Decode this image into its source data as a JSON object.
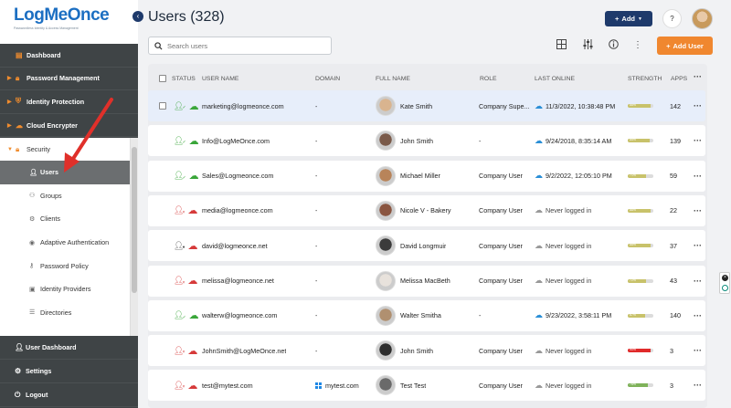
{
  "brand": {
    "name_part1": "LogMe",
    "name_part2": "Once",
    "tagline": "Passwordless Identity & Access Management"
  },
  "sidebar": {
    "top_items": [
      {
        "label": "Dashboard",
        "icon": "dashboard-icon"
      },
      {
        "label": "Password Management",
        "icon": "lock-icon"
      },
      {
        "label": "Identity Protection",
        "icon": "shield-icon"
      },
      {
        "label": "Cloud Encrypter",
        "icon": "cloud-icon"
      }
    ],
    "security": {
      "label": "Security",
      "icon": "lock-icon"
    },
    "sub_items": [
      {
        "label": "Users",
        "icon": "user-icon",
        "active": true
      },
      {
        "label": "Groups",
        "icon": "groups-icon"
      },
      {
        "label": "Clients",
        "icon": "clients-icon"
      },
      {
        "label": "Adaptive Authentication",
        "icon": "adaptive-icon"
      },
      {
        "label": "Password Policy",
        "icon": "key-icon"
      },
      {
        "label": "Identity Providers",
        "icon": "id-icon"
      },
      {
        "label": "Directories",
        "icon": "directory-icon"
      }
    ],
    "bottom_items": [
      {
        "label": "User Dashboard",
        "icon": "user-icon"
      },
      {
        "label": "Settings",
        "icon": "gear-icon"
      },
      {
        "label": "Logout",
        "icon": "power-icon"
      }
    ]
  },
  "header": {
    "title": "Users (328)",
    "add_label": "Add",
    "help_label": "?",
    "search_placeholder": "Search users",
    "add_user_label": "Add User"
  },
  "table": {
    "columns": [
      "STATUS",
      "USER NAME",
      "DOMAIN",
      "FULL NAME",
      "ROLE",
      "LAST ONLINE",
      "STRENGTH",
      "APPS"
    ],
    "rows": [
      {
        "status": "active",
        "username": "marketing@logmeonce.com",
        "domain": "-",
        "full_name": "Kate Smith",
        "role": "Company Supe...",
        "last_online": "11/3/2022, 10:38:48 PM",
        "online_type": "cloud",
        "strength": "88%",
        "strength_value": 0.88,
        "strength_color": "#c8c26a",
        "apps": "142",
        "face": "#d9b48f",
        "highlight": true
      },
      {
        "status": "active",
        "username": "Info@LogMeOnce.com",
        "domain": "-",
        "full_name": "John Smith",
        "role": "-",
        "last_online": "9/24/2018, 8:35:14 AM",
        "online_type": "cloud",
        "strength": "85%",
        "strength_value": 0.85,
        "strength_color": "#c8c26a",
        "apps": "139",
        "face": "#7a5a4a"
      },
      {
        "status": "active",
        "username": "Sales@Logmeonce.com",
        "domain": "-",
        "full_name": "Michael Miller",
        "role": "Company User",
        "last_online": "9/2/2022, 12:05:10 PM",
        "online_type": "cloud",
        "strength": "71%",
        "strength_value": 0.71,
        "strength_color": "#c8c26a",
        "apps": "59",
        "face": "#b8845a"
      },
      {
        "status": "inactive",
        "username": "media@logmeonce.com",
        "domain": "-",
        "full_name": "Nicole V - Bakery",
        "role": "Company User",
        "last_online": "Never logged in",
        "online_type": "never",
        "strength": "88%",
        "strength_value": 0.88,
        "strength_color": "#c8c26a",
        "apps": "22",
        "face": "#8a5540"
      },
      {
        "status": "pending",
        "username": "david@logmeonce.net",
        "domain": "-",
        "full_name": "David Longmuir",
        "role": "Company User",
        "last_online": "Never logged in",
        "online_type": "never",
        "strength": "88%",
        "strength_value": 0.88,
        "strength_color": "#c8c26a",
        "apps": "37",
        "face": "#3b3b3b"
      },
      {
        "status": "inactive",
        "username": "melissa@logmeonce.net",
        "domain": "-",
        "full_name": "Melissa MacBeth",
        "role": "Company User",
        "last_online": "Never logged in",
        "online_type": "never",
        "strength": "72%",
        "strength_value": 0.72,
        "strength_color": "#c8c26a",
        "apps": "43",
        "face": "#e8e2dc"
      },
      {
        "status": "active",
        "username": "walterw@logmeonce.com",
        "domain": "-",
        "full_name": "Walter Smitha",
        "role": "-",
        "last_online": "9/23/2022, 3:58:11 PM",
        "online_type": "cloud",
        "strength": "67%",
        "strength_value": 0.67,
        "strength_color": "#c8c26a",
        "apps": "140",
        "face": "#b09070"
      },
      {
        "status": "inactive",
        "username": "JohnSmith@LogMeOnce.net",
        "domain": "-",
        "full_name": "John Smith",
        "role": "Company User",
        "last_online": "Never logged in",
        "online_type": "never",
        "strength": "90%",
        "strength_value": 0.9,
        "strength_color": "#e02a2a",
        "apps": "3",
        "face": "#2e2e2e"
      },
      {
        "status": "inactive",
        "username": "test@mytest.com",
        "domain": "mytest.com",
        "full_name": "Test Test",
        "role": "Company User",
        "last_online": "Never logged in",
        "online_type": "never",
        "strength": "78%",
        "strength_value": 0.78,
        "strength_color": "#7fb25a",
        "apps": "3",
        "face": "#6a6a6a",
        "domain_icon": "windows-icon"
      }
    ]
  },
  "colors": {
    "accent_navy": "#1e3a6b",
    "accent_orange": "#f0872f",
    "sidebar_dark": "#3f4446"
  }
}
